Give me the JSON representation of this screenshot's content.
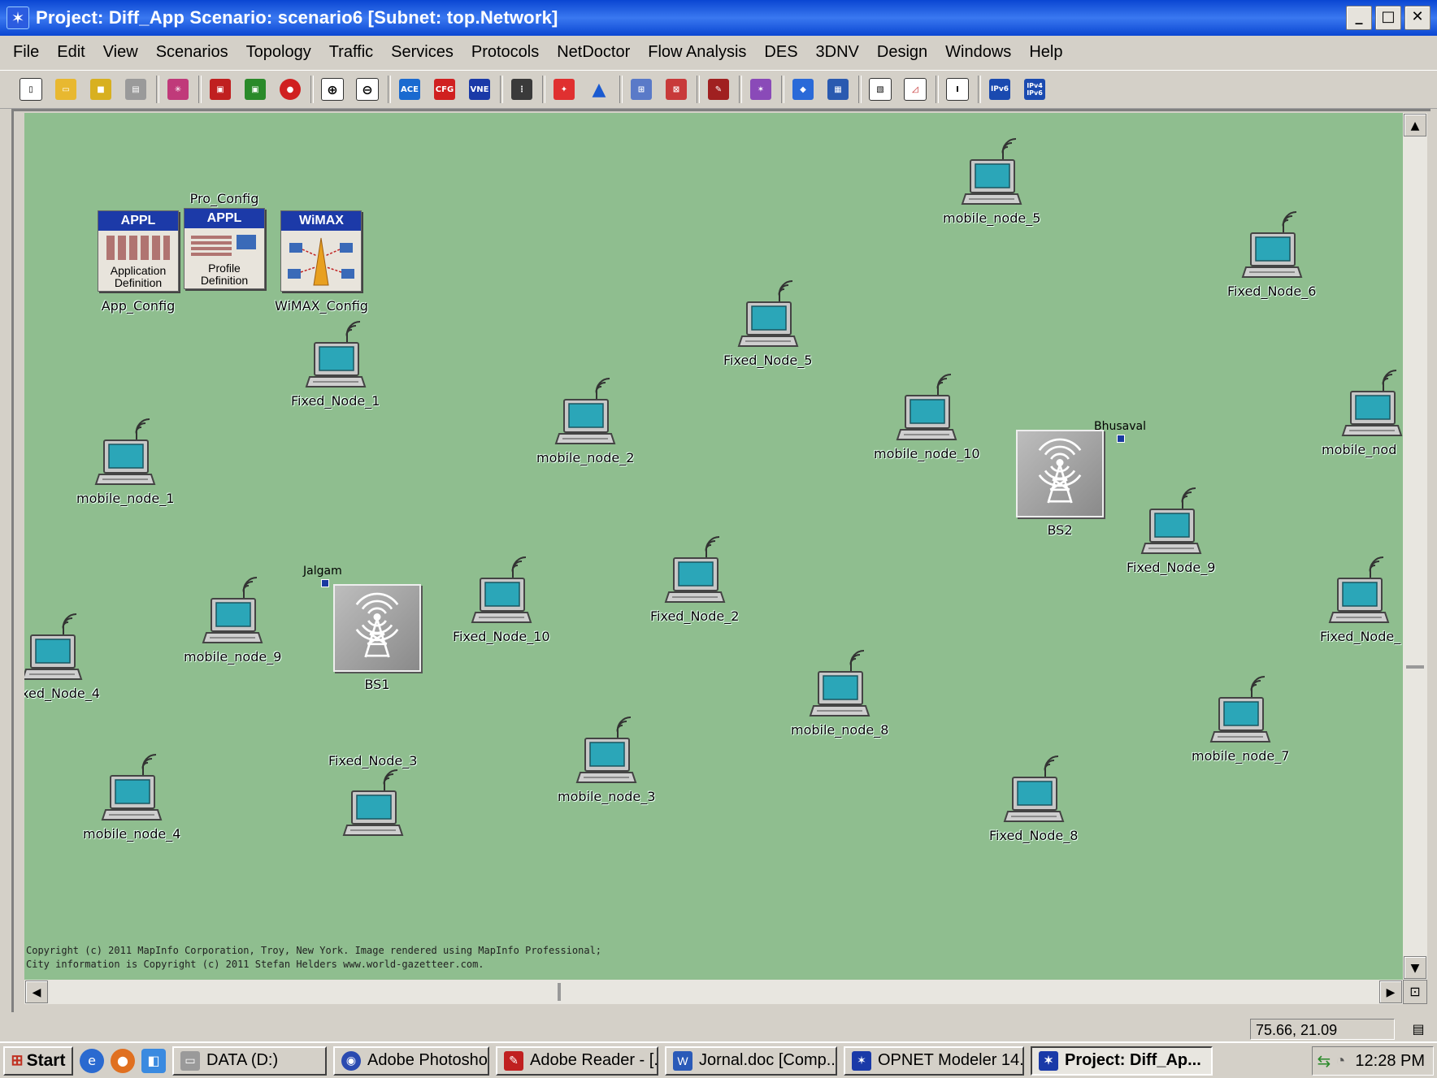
{
  "window": {
    "title": "Project: Diff_App Scenario: scenario6  [Subnet: top.Network]",
    "controls": [
      "_",
      "□",
      "✕"
    ]
  },
  "menu": [
    "File",
    "Edit",
    "View",
    "Scenarios",
    "Topology",
    "Traffic",
    "Services",
    "Protocols",
    "NetDoctor",
    "Flow Analysis",
    "DES",
    "3DNV",
    "Design",
    "Windows",
    "Help"
  ],
  "toolbar": {
    "ace_label": "ACE",
    "cfg_label": "CFG",
    "vne_label": "VNE",
    "ipv6_label": "IPv6",
    "ipv4v6_label": "IPv4 IPv6"
  },
  "config_objects": {
    "app_config": {
      "header": "APPL",
      "caption_top": "Application",
      "caption_bottom": "Definition",
      "label": "App_Config"
    },
    "pro_config": {
      "header": "APPL",
      "caption_top": "Profile",
      "caption_bottom": "Definition",
      "label": "Pro_Config"
    },
    "wimax_config": {
      "header": "WiMAX",
      "label": "WiMAX_Config"
    }
  },
  "nodes": {
    "mobile_node_5": "mobile_node_5",
    "fixed_node_6": "Fixed_Node_6",
    "fixed_node_5": "Fixed_Node_5",
    "fixed_node_1": "Fixed_Node_1",
    "mobile_node_2": "mobile_node_2",
    "mobile_node_10": "mobile_node_10",
    "mobile_node_6": "mobile_nod",
    "mobile_node_1": "mobile_node_1",
    "bs2": "BS2",
    "fixed_node_9": "Fixed_Node_9",
    "bs1": "BS1",
    "fixed_node_10": "Fixed_Node_10",
    "fixed_node_2": "Fixed_Node_2",
    "mobile_node_9": "mobile_node_9",
    "fixed_node_4": "xed_Node_4",
    "fixed_node_7": "Fixed_Node_",
    "mobile_node_8": "mobile_node_8",
    "mobile_node_7": "mobile_node_7",
    "mobile_node_3": "mobile_node_3",
    "mobile_node_4": "mobile_node_4",
    "fixed_node_3": "Fixed_Node_3",
    "fixed_node_8": "Fixed_Node_8"
  },
  "cities": {
    "bhusaval": "Bhusaval",
    "jalgam": "Jalgam"
  },
  "copyright": {
    "line1": "Copyright (c) 2011 MapInfo Corporation, Troy, New York. Image rendered using MapInfo Professional;",
    "line2": "City information is Copyright (c) 2011 Stefan Helders www.world-gazetteer.com."
  },
  "status": {
    "coordinates": "75.66, 21.09"
  },
  "taskbar": {
    "start": "Start",
    "tasks": [
      "DATA (D:)",
      "Adobe Photoshop",
      "Adobe Reader - [...",
      "Jornal.doc [Comp...",
      "OPNET Modeler 14...",
      "Project: Diff_Ap..."
    ],
    "clock": "12:28 PM"
  },
  "colors": {
    "map_background": "#8fbe8f",
    "titlebar": "#0a46d2",
    "screen": "#2ba6b8"
  }
}
